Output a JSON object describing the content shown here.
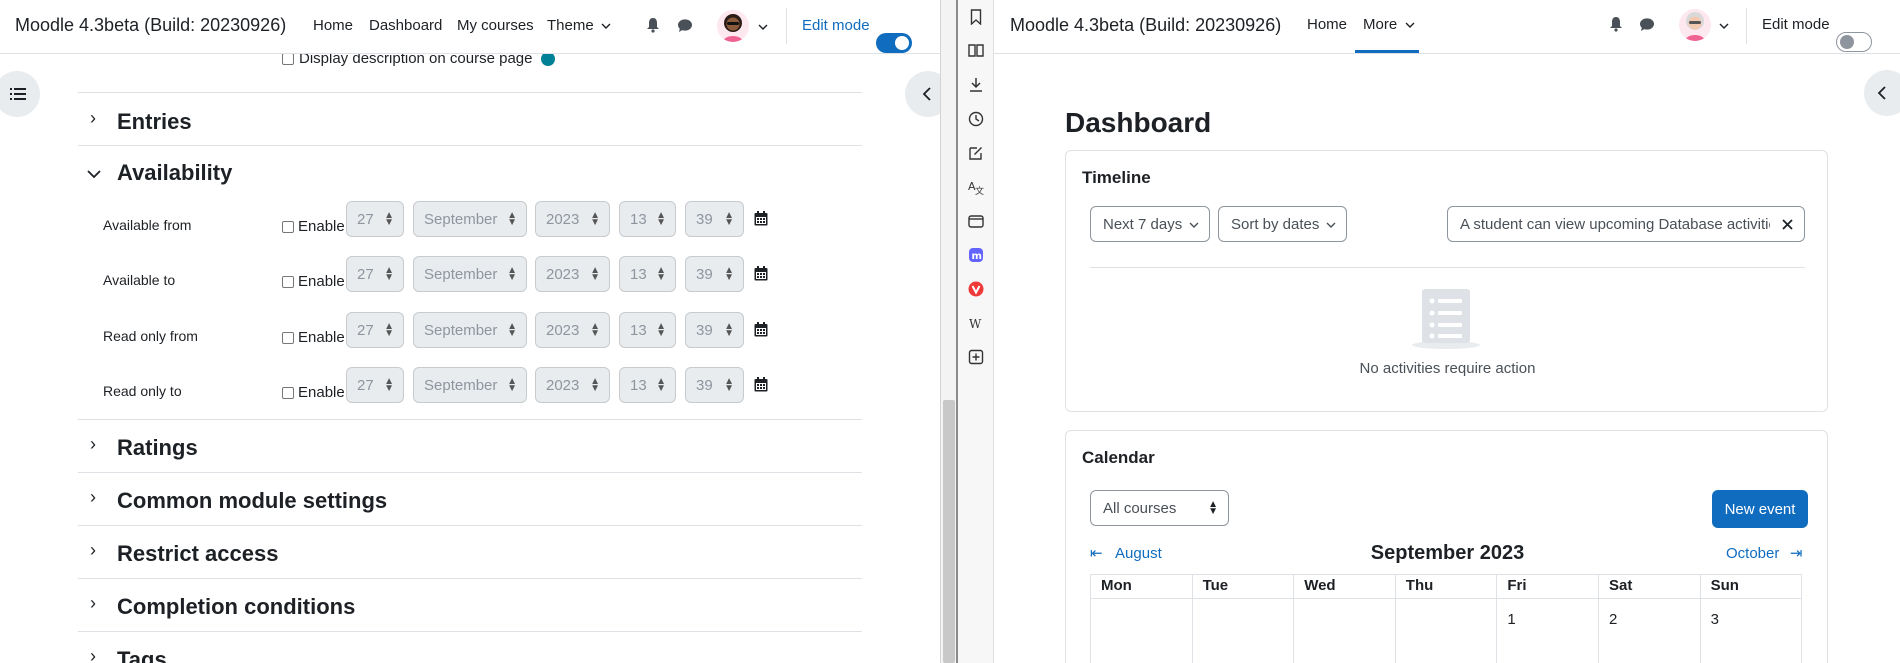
{
  "left": {
    "brand": "Moodle 4.3beta (Build: 20230926)",
    "nav": [
      "Home",
      "Dashboard",
      "My courses",
      "Theme"
    ],
    "edit_mode": "Edit mode",
    "partial_checkbox_label": "Display description on course page",
    "sections": {
      "entries": "Entries",
      "availability": "Availability",
      "ratings": "Ratings",
      "common": "Common module settings",
      "restrict": "Restrict access",
      "completion": "Completion conditions",
      "tags": "Tags"
    },
    "enable_label": "Enable",
    "date_rows": [
      {
        "label": "Available from",
        "day": "27",
        "month": "September",
        "year": "2023",
        "hour": "13",
        "minute": "39"
      },
      {
        "label": "Available to",
        "day": "27",
        "month": "September",
        "year": "2023",
        "hour": "13",
        "minute": "39"
      },
      {
        "label": "Read only from",
        "day": "27",
        "month": "September",
        "year": "2023",
        "hour": "13",
        "minute": "39"
      },
      {
        "label": "Read only to",
        "day": "27",
        "month": "September",
        "year": "2023",
        "hour": "13",
        "minute": "39"
      }
    ]
  },
  "right": {
    "brand": "Moodle 4.3beta (Build: 20230926)",
    "nav": [
      "Home",
      "More"
    ],
    "edit_mode": "Edit mode",
    "page_title": "Dashboard",
    "timeline": {
      "title": "Timeline",
      "filter": "Next 7 days",
      "sort": "Sort by dates",
      "search_value": "A student can view upcoming Database activitie",
      "empty_text": "No activities require action"
    },
    "calendar": {
      "title": "Calendar",
      "course_filter": "All courses",
      "new_event": "New event",
      "prev_month": "August",
      "next_month": "October",
      "month_title": "September 2023",
      "weekdays": [
        "Mon",
        "Tue",
        "Wed",
        "Thu",
        "Fri",
        "Sat",
        "Sun"
      ],
      "first_week": [
        "",
        "",
        "",
        "",
        "1",
        "2",
        "3"
      ]
    }
  },
  "colors": {
    "primary": "#0f6cbf",
    "toggle_on": "#0f6cbf",
    "toggle_off": "#ffffff"
  }
}
